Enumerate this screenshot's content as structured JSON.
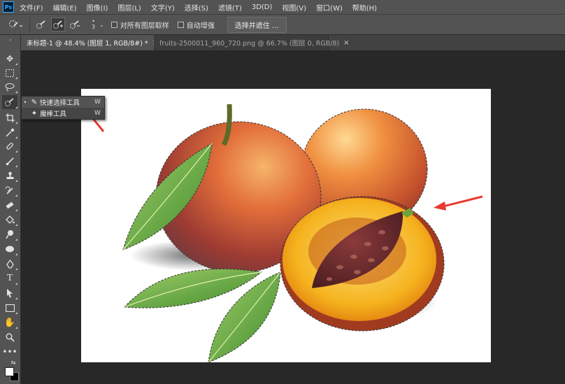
{
  "menubar": {
    "logo": "Ps",
    "items": [
      "文件(F)",
      "编辑(E)",
      "图像(I)",
      "图层(L)",
      "文字(Y)",
      "选择(S)",
      "滤镜(T)",
      "3D(D)",
      "视图(V)",
      "窗口(W)",
      "帮助(H)"
    ]
  },
  "options": {
    "brush_size": "3",
    "sample_all_layers_label": "对所有图层取样",
    "auto_enhance_label": "自动增强",
    "select_and_mask_label": "选择并遮住 ..."
  },
  "tabs": [
    {
      "title": "未标题-1 @ 48.4% (图层 1, RGB/8#) *",
      "close": "×"
    },
    {
      "title": "fruits-2500011_960_720.png @ 66.7% (图层 0, RGB/8)",
      "close": "×"
    }
  ],
  "flyout": {
    "items": [
      {
        "dot": "•",
        "label": "快速选择工具",
        "key": "W"
      },
      {
        "dot": "",
        "label": "魔棒工具",
        "key": "W"
      }
    ]
  },
  "toolbar": {
    "tools": [
      "move-icon",
      "marquee-icon",
      "lasso-icon",
      "quick-selection-icon",
      "crop-icon",
      "eyedropper-icon",
      "healing-brush-icon",
      "brush-icon",
      "clone-stamp-icon",
      "history-brush-icon",
      "eraser-icon",
      "paint-bucket-icon",
      "dodge-icon",
      "sponge-icon",
      "pen-icon",
      "type-icon",
      "path-selection-icon",
      "rectangle-icon",
      "hand-icon",
      "zoom-icon",
      "more-icon"
    ]
  },
  "colors": {
    "annotation_arrow": "#e83a30",
    "canvas": "#ffffff",
    "panel": "#535353"
  }
}
